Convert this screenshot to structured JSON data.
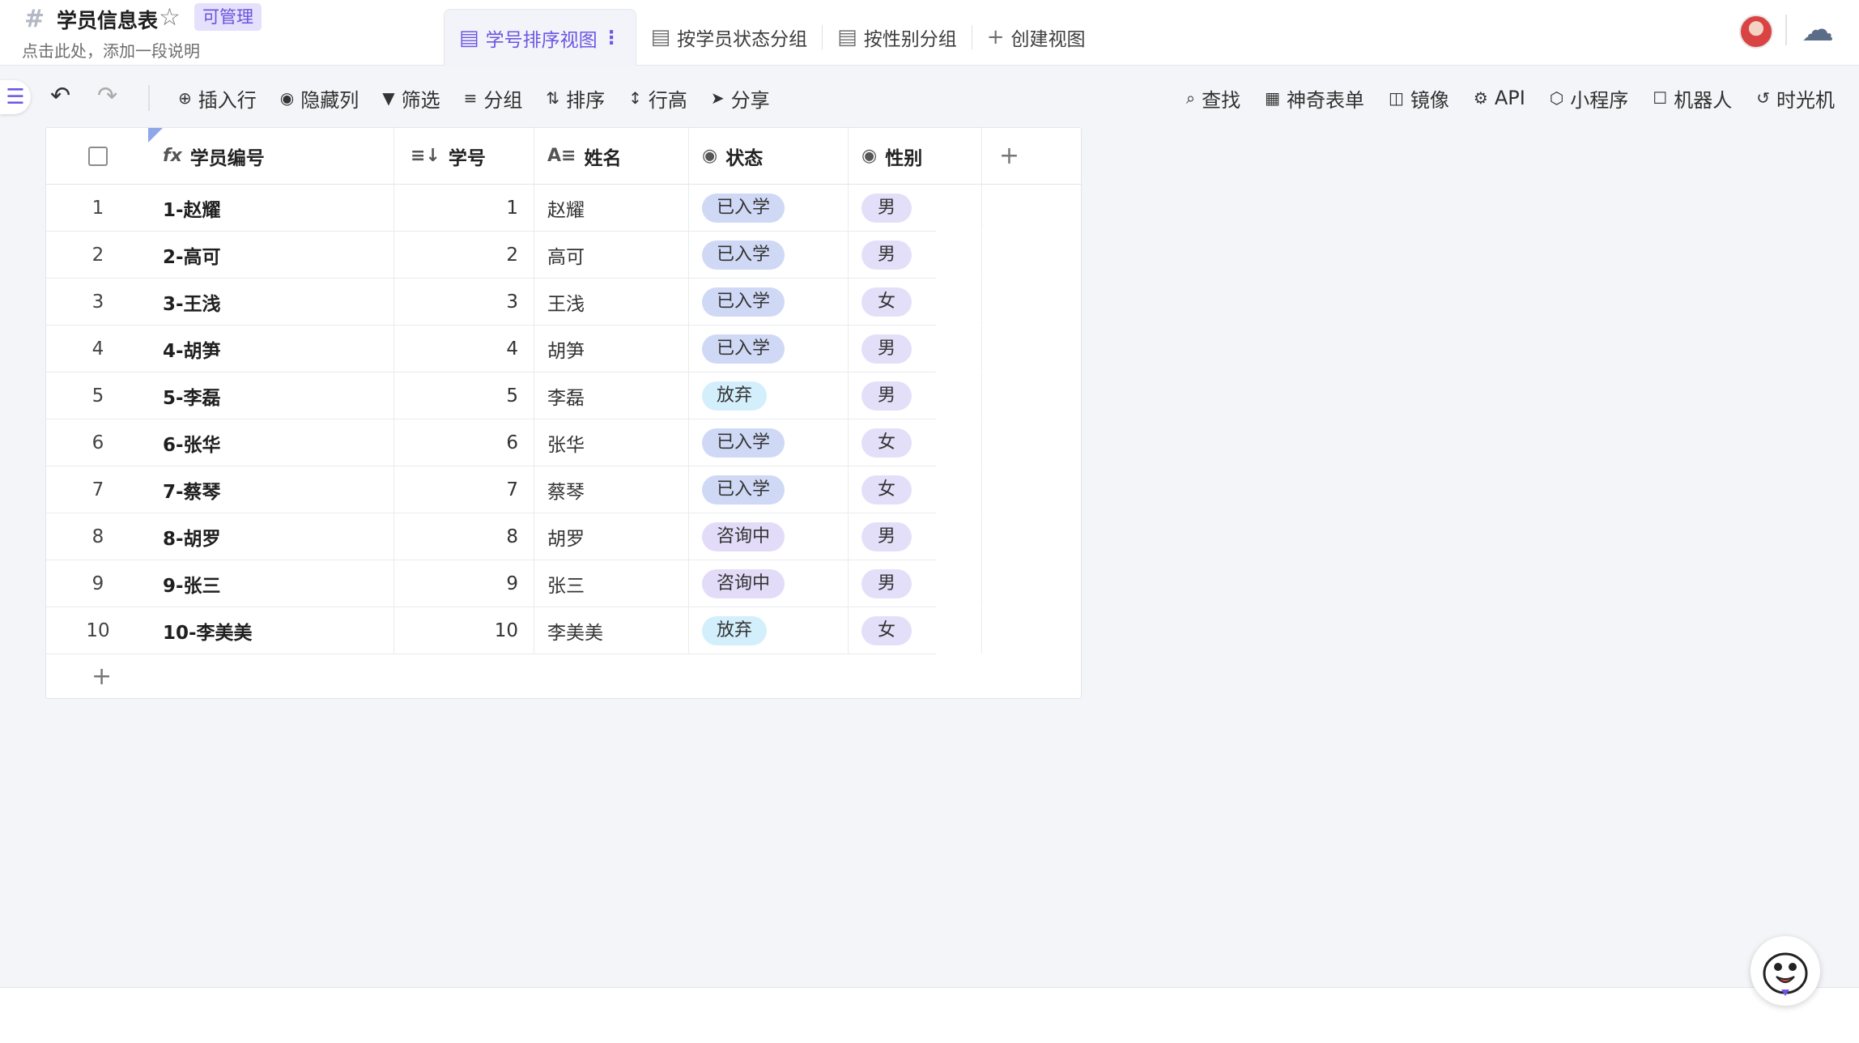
{
  "header": {
    "title": "学员信息表",
    "permission_badge": "可管理",
    "description": "点击此处，添加一段说明"
  },
  "views": {
    "tabs": [
      {
        "label": "学号排序视图",
        "active": true
      },
      {
        "label": "按学员状态分组",
        "active": false
      },
      {
        "label": "按性别分组",
        "active": false
      }
    ],
    "create_label": "创建视图"
  },
  "toolbar": {
    "left": [
      "插入行",
      "隐藏列",
      "筛选",
      "分组",
      "排序",
      "行高",
      "分享"
    ],
    "right": [
      "查找",
      "神奇表单",
      "镜像",
      "API",
      "小程序",
      "机器人",
      "时光机"
    ]
  },
  "table": {
    "columns": [
      "学员编号",
      "学号",
      "姓名",
      "状态",
      "性别"
    ],
    "rows": [
      {
        "num": "1",
        "code": "1-赵耀",
        "id": "1",
        "name": "赵耀",
        "status": "已入学",
        "gender": "男"
      },
      {
        "num": "2",
        "code": "2-高可",
        "id": "2",
        "name": "高可",
        "status": "已入学",
        "gender": "男"
      },
      {
        "num": "3",
        "code": "3-王浅",
        "id": "3",
        "name": "王浅",
        "status": "已入学",
        "gender": "女"
      },
      {
        "num": "4",
        "code": "4-胡笋",
        "id": "4",
        "name": "胡笋",
        "status": "已入学",
        "gender": "男"
      },
      {
        "num": "5",
        "code": "5-李磊",
        "id": "5",
        "name": "李磊",
        "status": "放弃",
        "gender": "男"
      },
      {
        "num": "6",
        "code": "6-张华",
        "id": "6",
        "name": "张华",
        "status": "已入学",
        "gender": "女"
      },
      {
        "num": "7",
        "code": "7-蔡琴",
        "id": "7",
        "name": "蔡琴",
        "status": "已入学",
        "gender": "女"
      },
      {
        "num": "8",
        "code": "8-胡罗",
        "id": "8",
        "name": "胡罗",
        "status": "咨询中",
        "gender": "男"
      },
      {
        "num": "9",
        "code": "9-张三",
        "id": "9",
        "name": "张三",
        "status": "咨询中",
        "gender": "男"
      },
      {
        "num": "10",
        "code": "10-李美美",
        "id": "10",
        "name": "李美美",
        "status": "放弃",
        "gender": "女"
      }
    ]
  },
  "colors": {
    "accent": "#6d55e3",
    "status_enrolled": "#cfd9f6",
    "status_quit": "#d4effc",
    "status_consulting": "#e3dcf8",
    "gender_tag": "#e4dff9"
  }
}
